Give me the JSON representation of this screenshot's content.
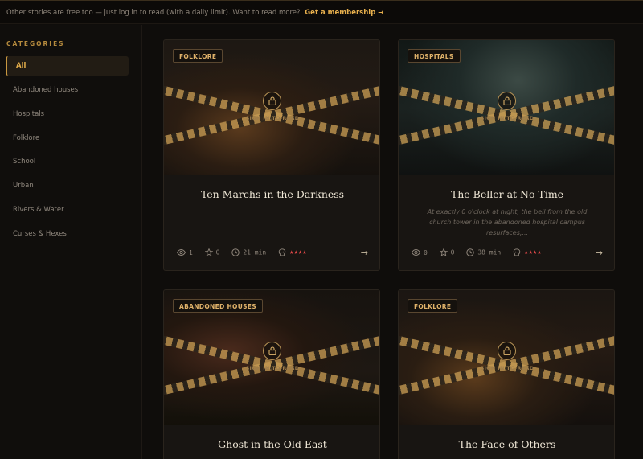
{
  "banner": {
    "text": "Other stories are free too — just log in to read (with a daily limit). Want to read more?",
    "cta": "Get a membership →"
  },
  "sidebar": {
    "heading": "CATEGORIES",
    "items": [
      {
        "label": "All",
        "active": true
      },
      {
        "label": "Abandoned houses"
      },
      {
        "label": "Hospitals"
      },
      {
        "label": "Folklore"
      },
      {
        "label": "School"
      },
      {
        "label": "Urban"
      },
      {
        "label": "Rivers & Water"
      },
      {
        "label": "Curses & Hexes"
      }
    ]
  },
  "cards": [
    {
      "category": "FOLKLORE",
      "lock_label": "SIGN IN TO READ",
      "title": "Ten Marchs in the Darkness",
      "description": "",
      "views": "1",
      "favorites": "0",
      "read_time": "21 min",
      "rating_stars": "★★★★",
      "rating": 4
    },
    {
      "category": "HOSPITALS",
      "lock_label": "SIGN IN TO READ",
      "title": "The Beller at No Time",
      "description": "At exactly 0 o'clock at night, the bell from the old church tower in the abandoned hospital campus resurfaces,...",
      "views": "0",
      "favorites": "0",
      "read_time": "38 min",
      "rating_stars": "★★★★",
      "rating": 4
    },
    {
      "category": "ABANDONED HOUSES",
      "lock_label": "SIGN IN TO READ",
      "title": "Ghost in the Old East",
      "description": ""
    },
    {
      "category": "FOLKLORE",
      "lock_label": "SIGN IN TO READ",
      "title": "The Face of Others",
      "description": ""
    }
  ],
  "colors": {
    "accent": "#e3ad4a",
    "background": "#0f0d0b",
    "card": "#181512",
    "rating": "#e04848"
  }
}
